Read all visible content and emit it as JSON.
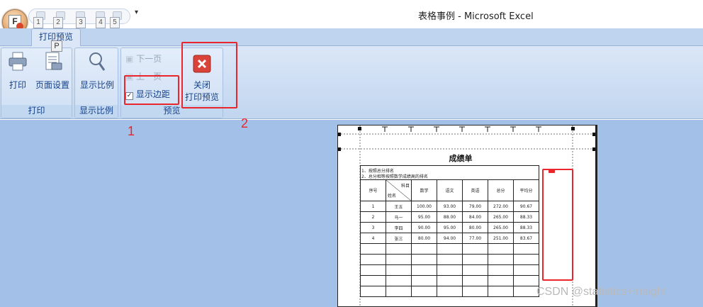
{
  "title_bar": {
    "document_title": "表格事例 - Microsoft Excel",
    "office_logo_letter": "F",
    "qat_keytips": [
      "1",
      "2",
      "3",
      "4",
      "5"
    ],
    "qat_overflow": "▾"
  },
  "ribbon": {
    "active_tab": "打印预览",
    "tab_keytip": "P",
    "groups": {
      "print": {
        "label": "打印",
        "buttons": [
          "打印",
          "页面设置"
        ]
      },
      "zoom": {
        "label": "显示比例",
        "buttons": [
          "显示比例"
        ]
      },
      "preview": {
        "label": "预览",
        "next_page": "下一页",
        "prev_page": "上一页",
        "show_margins": "显示边距",
        "show_margins_checked": true,
        "close_line1": "关闭",
        "close_line2": "打印预览"
      }
    }
  },
  "annotations": {
    "label_1": "1",
    "label_2": "2",
    "color": "#e8262c"
  },
  "preview_page": {
    "heading": "成绩单",
    "notes": [
      "1、按照总分排名",
      "2、总分相等按照数学成绩高的排名"
    ],
    "table": {
      "headers": [
        "序号",
        "科目",
        "姓名",
        "数学",
        "语文",
        "英语",
        "总分",
        "平均分"
      ],
      "rows": [
        [
          "1",
          "王五",
          "100.00",
          "93.00",
          "79.00",
          "272.00",
          "90.67"
        ],
        [
          "2",
          "马一",
          "95.00",
          "88.00",
          "84.00",
          "265.00",
          "88.33"
        ],
        [
          "3",
          "李四",
          "90.00",
          "95.00",
          "80.00",
          "265.00",
          "88.33"
        ],
        [
          "4",
          "张三",
          "80.00",
          "94.00",
          "77.00",
          "251.00",
          "83.67"
        ]
      ],
      "empty_rows": 5
    }
  },
  "watermark": "CSDN @statistics+insight"
}
